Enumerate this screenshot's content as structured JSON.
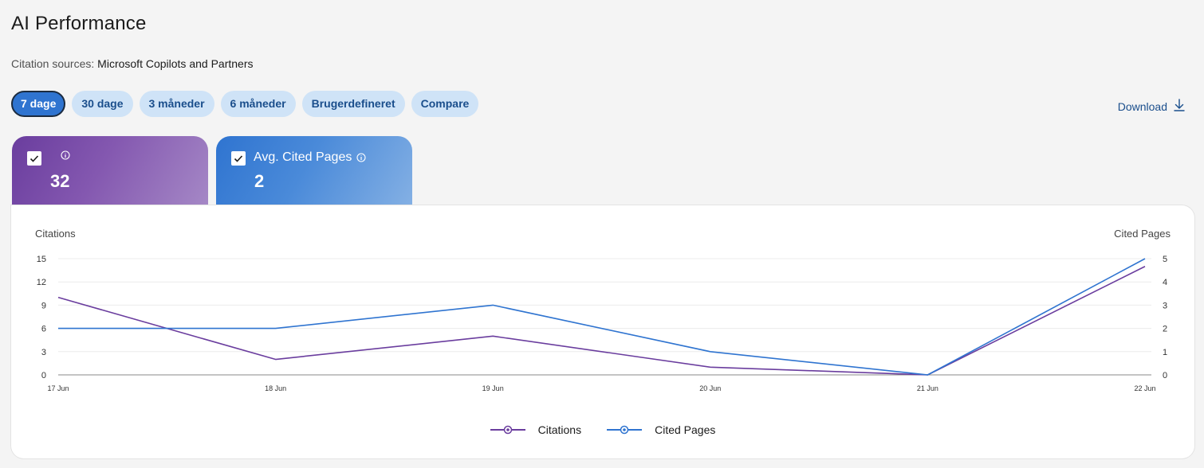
{
  "page": {
    "title": "AI Performance",
    "sources_label": "Citation sources:",
    "sources_value": "Microsoft Copilots and Partners"
  },
  "filters": {
    "items": [
      "7 dage",
      "30 dage",
      "3 måneder",
      "6 måneder",
      "Brugerdefineret",
      "Compare"
    ],
    "active": "7 dage"
  },
  "download": {
    "label": "Download",
    "icon": "download-icon"
  },
  "cards": [
    {
      "label": "",
      "value": "32",
      "checked": true,
      "color": "#6a3d9e",
      "icon": "info-icon"
    },
    {
      "label": "Avg. Cited Pages",
      "value": "2",
      "checked": true,
      "color": "#2f74d0",
      "icon": "info-icon"
    }
  ],
  "colors": {
    "citations": "#6a3d9e",
    "cited_pages": "#2f74d0",
    "grid": "#ececec",
    "axis": "#8a8a8a"
  },
  "chart_data": {
    "type": "line",
    "x": [
      "17 Jun",
      "18 Jun",
      "19 Jun",
      "20 Jun",
      "21 Jun",
      "22 Jun"
    ],
    "y_left_label": "Citations",
    "y_right_label": "Cited Pages",
    "y_left_ticks": [
      "0",
      "3",
      "6",
      "9",
      "12",
      "15"
    ],
    "y_right_ticks": [
      "0",
      "1",
      "2",
      "3",
      "4",
      "5"
    ],
    "y_left_range": [
      0,
      15
    ],
    "y_right_range": [
      0,
      5
    ],
    "grid": true,
    "legend_position": "bottom",
    "series": [
      {
        "name": "Citations",
        "axis": "left",
        "values": [
          10,
          2,
          5,
          1,
          0,
          14
        ]
      },
      {
        "name": "Cited Pages",
        "axis": "right",
        "values": [
          2,
          2,
          3,
          1,
          0,
          5
        ]
      }
    ]
  }
}
